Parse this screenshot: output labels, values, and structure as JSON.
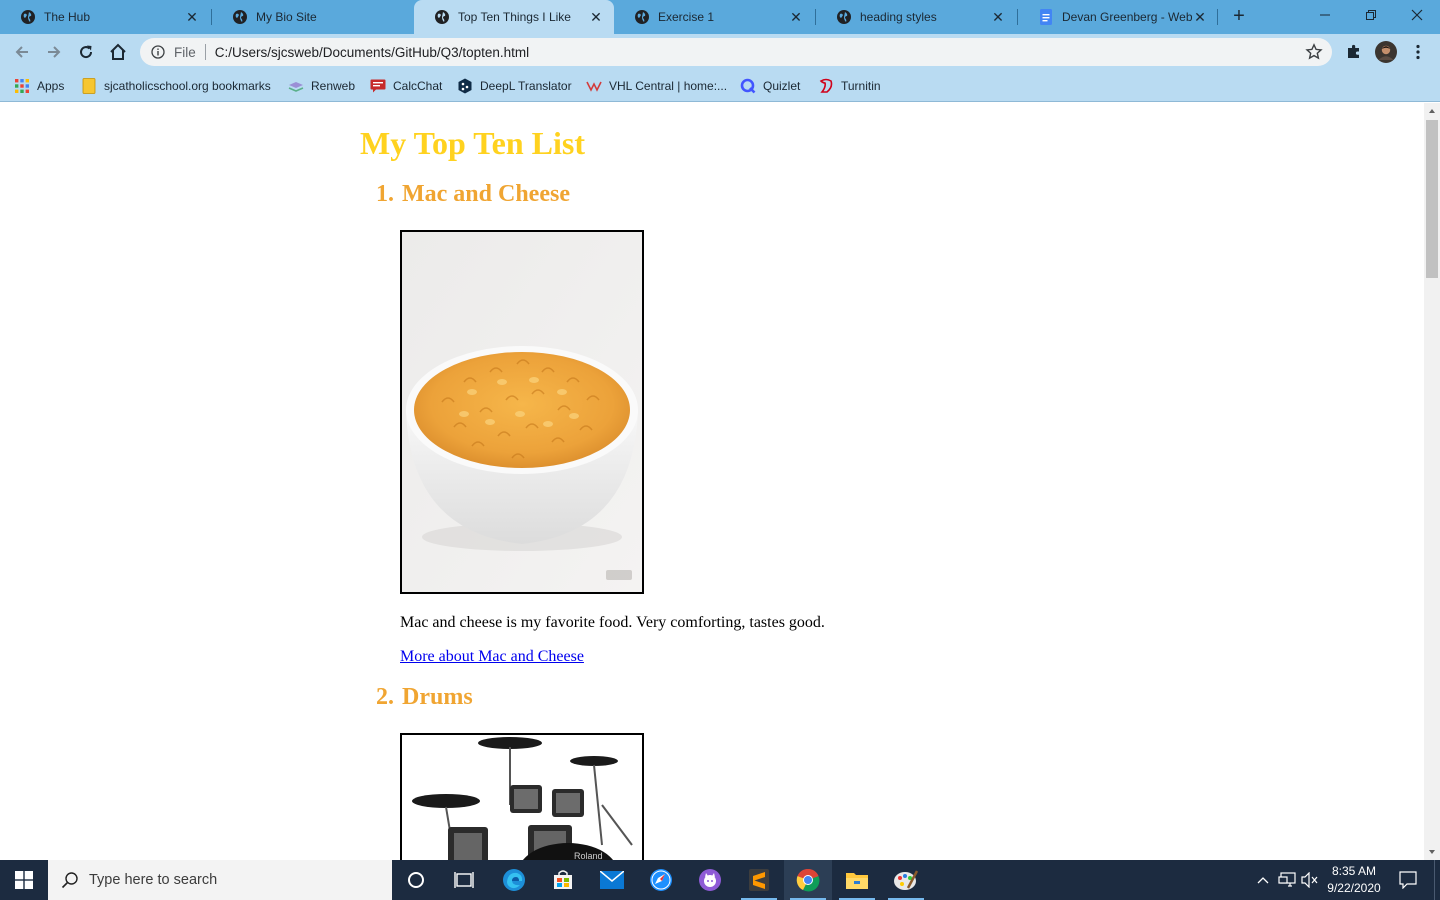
{
  "browser": {
    "tabs": [
      {
        "title": "The Hub",
        "favicon": "globe-icon",
        "active": false
      },
      {
        "title": "My Bio Site",
        "favicon": "globe-icon",
        "active": false
      },
      {
        "title": "Top Ten Things I Like",
        "favicon": "globe-icon",
        "active": true
      },
      {
        "title": "Exercise 1",
        "favicon": "globe-icon",
        "active": false
      },
      {
        "title": "heading styles",
        "favicon": "globe-icon",
        "active": false
      },
      {
        "title": "Devan Greenberg - Web D",
        "favicon": "google-docs-icon",
        "active": false
      }
    ],
    "address_bar": {
      "scheme_label": "File",
      "url": "C:/Users/sjcsweb/Documents/GitHub/Q3/topten.html"
    },
    "bookmarks": [
      {
        "label": "Apps",
        "icon": "apps-grid-icon"
      },
      {
        "label": "sjcatholicschool.org bookmarks",
        "icon": "folder-icon"
      },
      {
        "label": "Renweb",
        "icon": "renweb-icon"
      },
      {
        "label": "CalcChat",
        "icon": "calcchat-icon"
      },
      {
        "label": "DeepL Translator",
        "icon": "deepl-icon"
      },
      {
        "label": "VHL Central | home:...",
        "icon": "vhl-icon"
      },
      {
        "label": "Quizlet",
        "icon": "quizlet-icon"
      },
      {
        "label": "Turnitin",
        "icon": "turnitin-icon"
      }
    ],
    "colors": {
      "frame": "#5aa9dc",
      "toolbar": "#b9dbf2"
    }
  },
  "page": {
    "title": "My Top Ten List",
    "title_color": "#ffd21f",
    "heading_color": "#f0a532",
    "items": [
      {
        "number": "1.",
        "name": "Mac and Cheese",
        "image": "mac-and-cheese-bowl",
        "description": "Mac and cheese is my favorite food. Very comforting, tastes good.",
        "link_text": "More about Mac and Cheese"
      },
      {
        "number": "2.",
        "name": "Drums",
        "image": "drum-kit",
        "image_brand_text": "Roland"
      }
    ]
  },
  "taskbar": {
    "search_placeholder": "Type here to search",
    "apps": [
      "start-icon",
      "cortana-icon",
      "task-view-icon",
      "edge-icon",
      "store-icon",
      "mail-icon",
      "safari-icon",
      "github-desktop-icon",
      "sublime-text-icon",
      "chrome-icon",
      "file-explorer-icon",
      "paint-icon"
    ],
    "time": "8:35 AM",
    "date": "9/22/2020"
  }
}
